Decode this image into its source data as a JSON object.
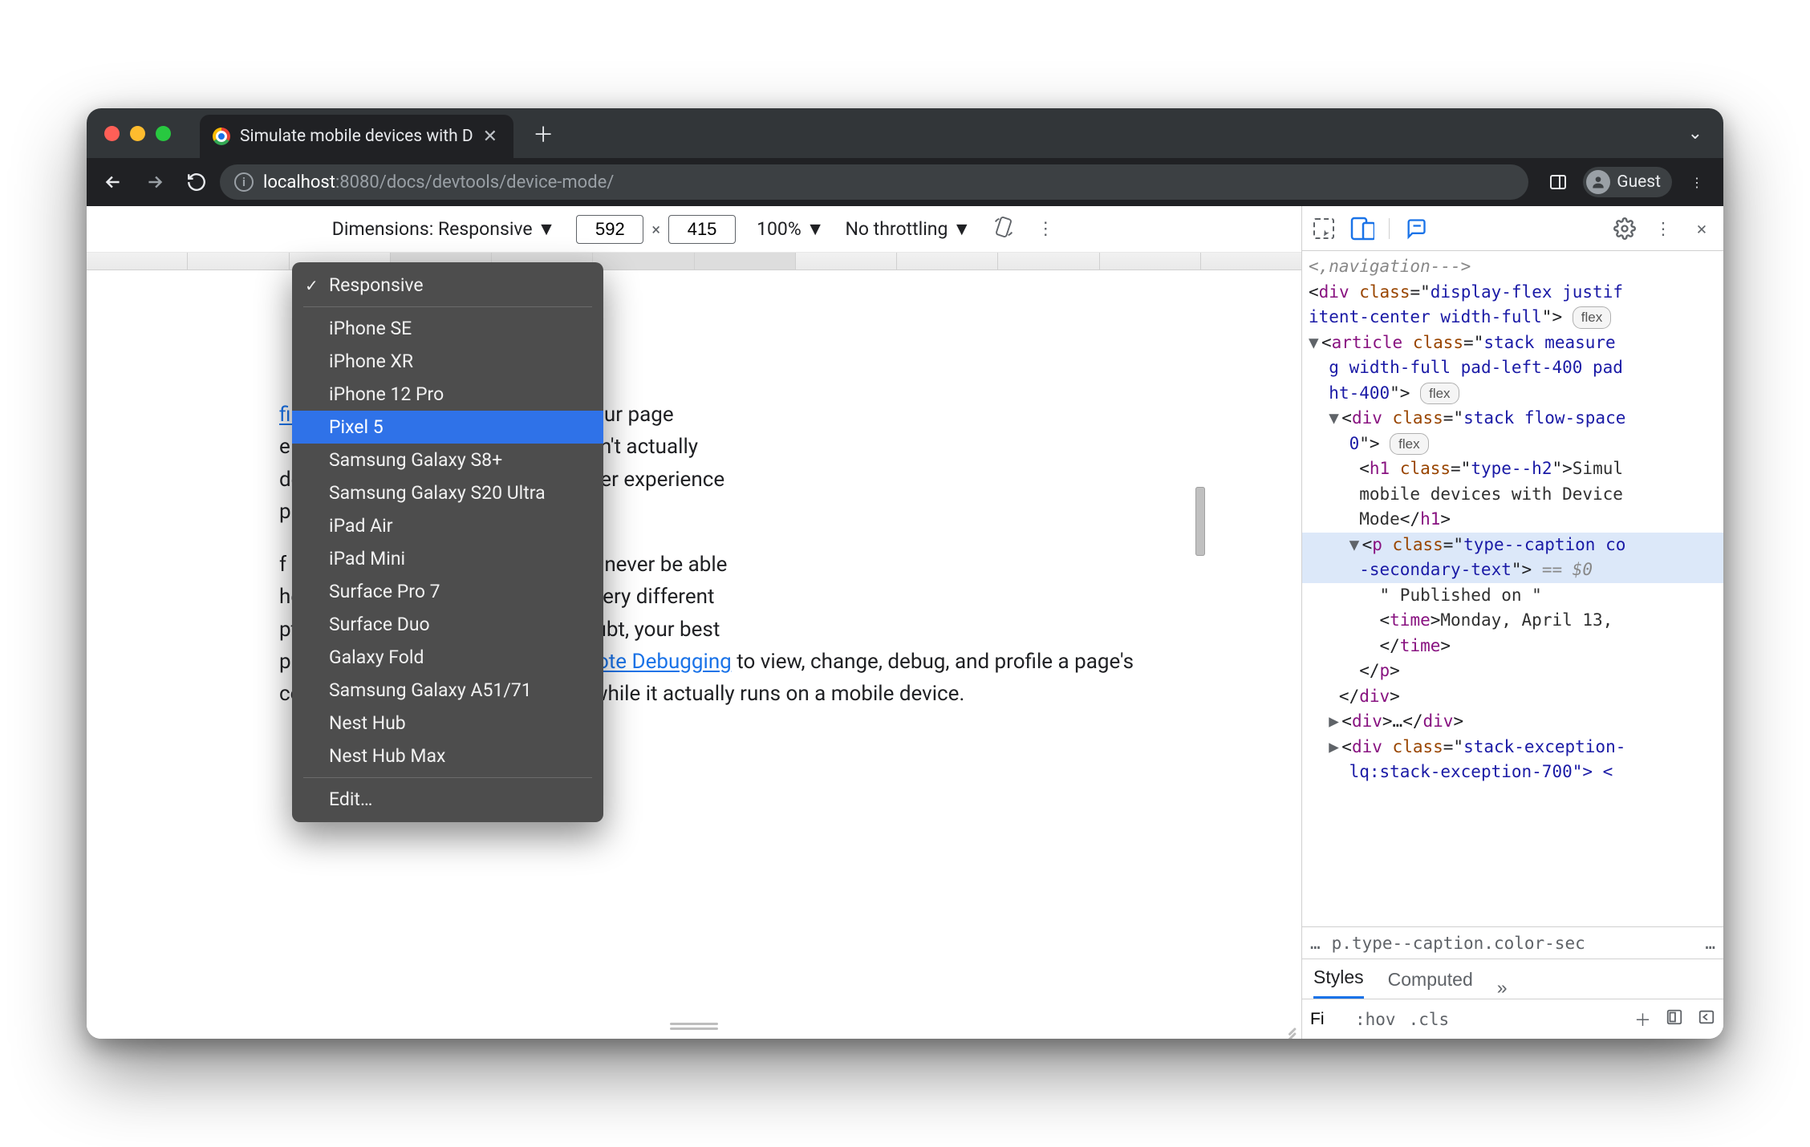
{
  "window": {
    "tab_title": "Simulate mobile devices with D",
    "guest_label": "Guest"
  },
  "url": {
    "host": "localhost",
    "rest": ":8080/docs/devtools/device-mode/"
  },
  "device_toolbar": {
    "dimensions_label": "Dimensions: Responsive",
    "width": "592",
    "height": "415",
    "zoom": "100%",
    "throttling": "No throttling"
  },
  "dropdown": {
    "checked": "Responsive",
    "items": [
      "iPhone SE",
      "iPhone XR",
      "iPhone 12 Pro",
      "Pixel 5",
      "Samsung Galaxy S8+",
      "Samsung Galaxy S20 Ultra",
      "iPad Air",
      "iPad Mini",
      "Surface Pro 7",
      "Surface Duo",
      "Galaxy Fold",
      "Samsung Galaxy A51/71",
      "Nest Hub",
      "Nest Hub Max"
    ],
    "highlight_index": 3,
    "edit": "Edit…"
  },
  "page": {
    "p1a": "first-order approximation",
    "p1b": " of how your page",
    "p1c": "e device. With Device Mode you don't actually",
    "p1d": "device. You simulate the mobile user experience",
    "p1e": "p.",
    "p2a": "f mobile devices that DevTools will never be able",
    "p2b": "he architecture of mobile CPUs is very different",
    "p2c": "ptop or desktop CPUs. When in doubt, your best",
    "p2d": "page on a mobile device. Use ",
    "p2_link": "Remote Debugging",
    "p2e": " to view, change, debug, and profile a page's code from your laptop or desktop while it actually runs on a mobile device."
  },
  "devtools": {
    "elements": {
      "line0": "&lt;,navigation---&gt;",
      "line1_a": "div",
      "line1_b": "class",
      "line1_c": "display-flex justif",
      "line2": "itent-center width-full",
      "line3_a": "article",
      "line3_b": "class",
      "line3_c": "stack measure",
      "line4": "g width-full pad-left-400 pad",
      "line5": "ht-400",
      "line6_a": "div",
      "line6_b": "class",
      "line6_c": "stack flow-space",
      "line7": "0",
      "line8_a": "h1",
      "line8_b": "class",
      "line8_c": "type--h2",
      "line8_d": "Simul",
      "line9": "mobile devices with Device",
      "line10a": "Mode",
      "line10b": "h1",
      "line11_a": "p",
      "line11_b": "class",
      "line11_c": "type--caption co",
      "line12a": "-secondary-text",
      "line12b": " == $0",
      "line13": "\" Published on \"",
      "line14a": "time",
      "line14b": "Monday, April 13,",
      "line15": "time",
      "line16": "p",
      "line17": "div",
      "line18a": "div",
      "line18b": "…",
      "line18c": "div",
      "line19_a": "div",
      "line19_b": "class",
      "line19_c": "stack-exception-",
      "line20": "lq:stack-exception-700\"> <"
    },
    "breadcrumb": "p.type--caption.color-sec",
    "tabs": {
      "styles": "Styles",
      "computed": "Computed"
    },
    "filter": {
      "placeholder": "Fi",
      "hov": ":hov",
      "cls": ".cls"
    },
    "flex_pill": "flex"
  }
}
